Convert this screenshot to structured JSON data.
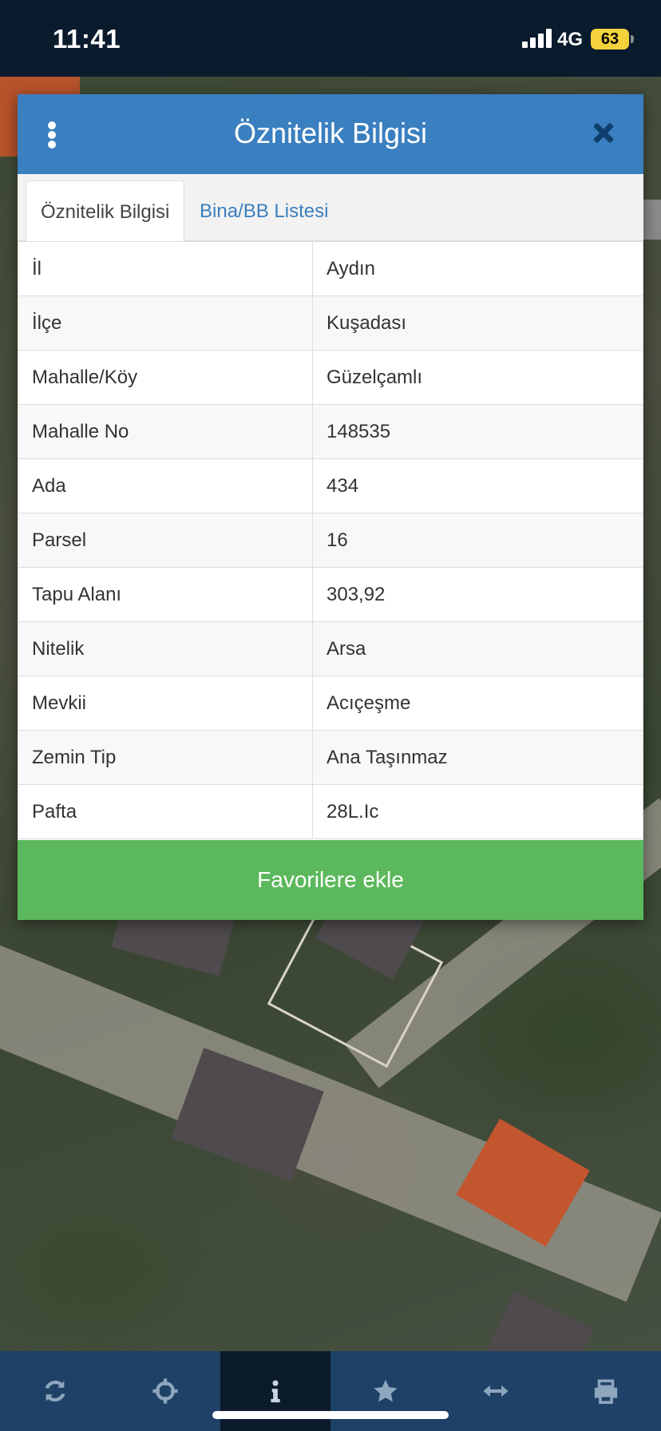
{
  "status_bar": {
    "time": "11:41",
    "network": "4G",
    "battery": "63",
    "battery_color": "#f4d23c"
  },
  "dialog": {
    "title": "Öznitelik Bilgisi",
    "header_color": "#3a7fbf",
    "tabs": [
      {
        "label": "Öznitelik Bilgisi",
        "active": true
      },
      {
        "label": "Bina/BB Listesi",
        "active": false
      }
    ],
    "rows": [
      {
        "key": "İl",
        "value": "Aydın"
      },
      {
        "key": "İlçe",
        "value": "Kuşadası"
      },
      {
        "key": "Mahalle/Köy",
        "value": "Güzelçamlı"
      },
      {
        "key": "Mahalle No",
        "value": "148535"
      },
      {
        "key": "Ada",
        "value": "434"
      },
      {
        "key": "Parsel",
        "value": "16"
      },
      {
        "key": "Tapu Alanı",
        "value": "303,92"
      },
      {
        "key": "Nitelik",
        "value": "Arsa"
      },
      {
        "key": "Mevkii",
        "value": "Acıçeşme"
      },
      {
        "key": "Zemin Tip",
        "value": "Ana Taşınmaz"
      },
      {
        "key": "Pafta",
        "value": "28L.Ic"
      }
    ],
    "favorite_button": "Favorilere ekle",
    "favorite_color": "#5cb85c"
  },
  "toolbar": {
    "items": [
      {
        "icon": "refresh-icon",
        "active": false
      },
      {
        "icon": "crosshair-icon",
        "active": false
      },
      {
        "icon": "info-icon",
        "active": true
      },
      {
        "icon": "star-icon",
        "active": false
      },
      {
        "icon": "measure-icon",
        "active": false
      },
      {
        "icon": "print-icon",
        "active": false
      }
    ]
  }
}
